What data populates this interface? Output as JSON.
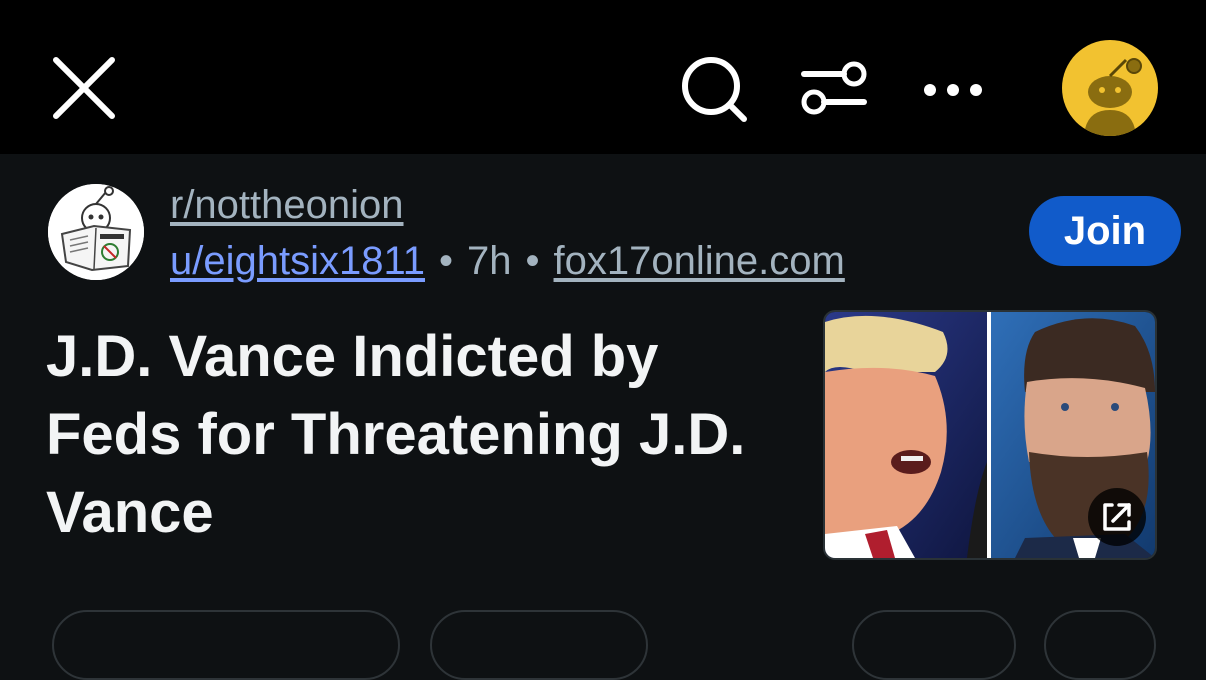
{
  "topbar": {
    "icons": [
      "close-icon",
      "search-icon",
      "filter-icon",
      "more-icon",
      "avatar"
    ]
  },
  "post": {
    "subreddit": "r/nottheonion",
    "username": "u/eightsix1811",
    "separator_1": "•",
    "time_ago": "7h",
    "separator_2": "•",
    "domain": "fox17online.com",
    "join_label": "Join",
    "title": "J.D. Vance Indicted by Feds for Threatening J.D. Vance",
    "thumbnail_icon": "external-link-icon"
  },
  "colors": {
    "topbar_bg": "#000000",
    "page_bg": "#0e1113",
    "join_bg": "#115bca",
    "username": "#7a9cff",
    "meta_text": "#a3b3bf",
    "title_text": "#f2f4f5",
    "avatar_bg": "#f2c230"
  }
}
